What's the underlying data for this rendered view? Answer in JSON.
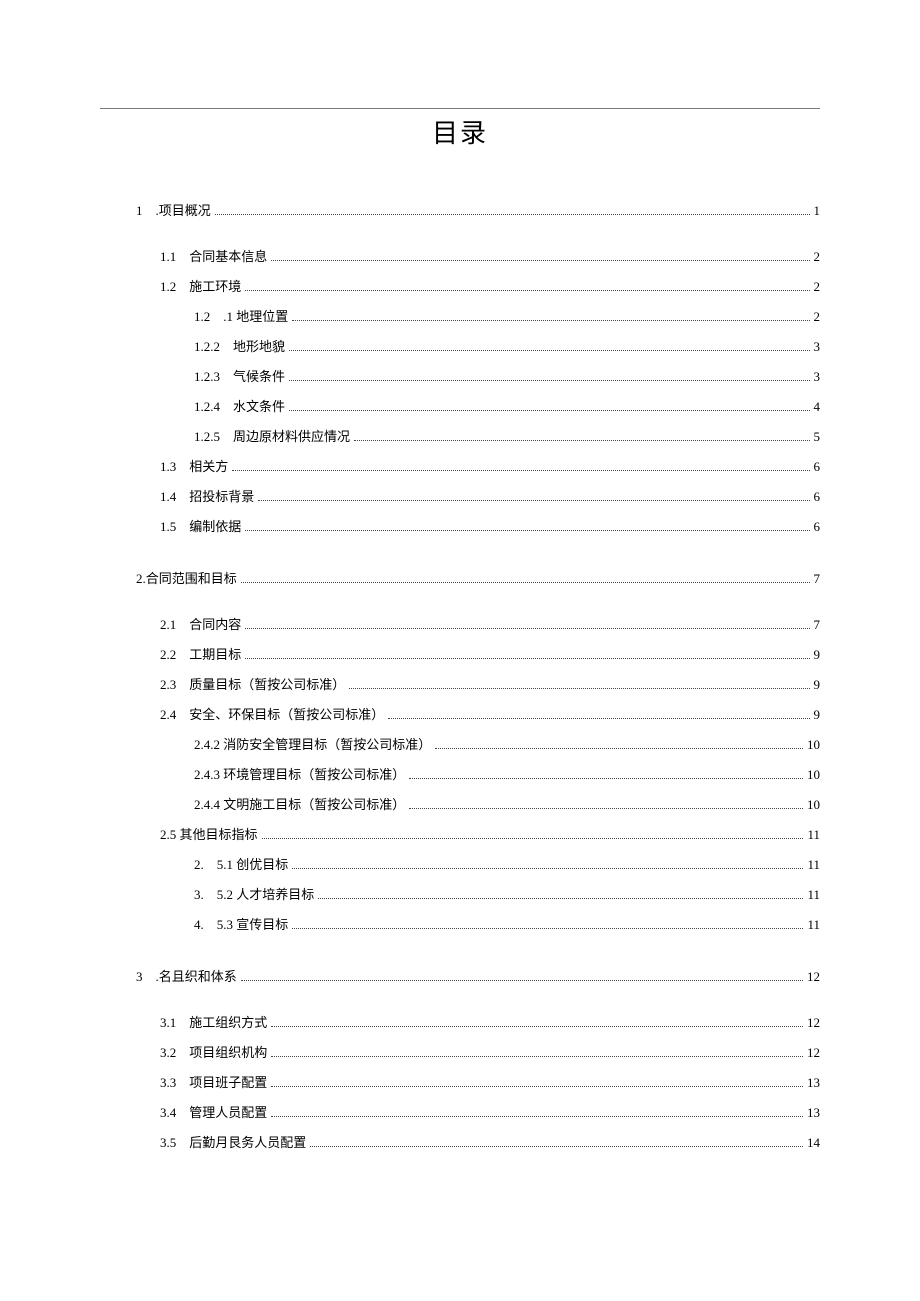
{
  "title": "目录",
  "toc": [
    {
      "level": 1,
      "num": "1",
      "sep": " .",
      "text": "项目概况",
      "page": "1",
      "gapAfter": true
    },
    {
      "level": 2,
      "num": "1.1",
      "sep": " ",
      "text": "合同基本信息",
      "page": "2"
    },
    {
      "level": 2,
      "num": "1.2",
      "sep": " ",
      "text": "施工环境",
      "page": "2"
    },
    {
      "level": 3,
      "num": "1.2",
      "sep": " ",
      "text": ".1 地理位置",
      "page": "2"
    },
    {
      "level": 3,
      "num": "1.2.2",
      "sep": " ",
      "text": "地形地貌",
      "page": "3"
    },
    {
      "level": 3,
      "num": "1.2.3",
      "sep": " ",
      "text": "气候条件",
      "page": "3"
    },
    {
      "level": 3,
      "num": "1.2.4",
      "sep": " ",
      "text": "水文条件",
      "page": "4"
    },
    {
      "level": 3,
      "num": "1.2.5",
      "sep": " ",
      "text": "周边原材料供应情况",
      "page": "5"
    },
    {
      "level": 2,
      "num": "1.3",
      "sep": " ",
      "text": "相关方",
      "page": "6"
    },
    {
      "level": 2,
      "num": "1.4",
      "sep": " ",
      "text": "招投标背景",
      "page": "6"
    },
    {
      "level": 2,
      "num": "1.5",
      "sep": " ",
      "text": "编制依据",
      "page": "6",
      "gapAfter": true
    },
    {
      "level": 1,
      "num": "2.",
      "sep": "",
      "text": "合同范围和目标",
      "page": "7",
      "gapAfter": true
    },
    {
      "level": 2,
      "num": "2.1",
      "sep": " ",
      "text": "合同内容",
      "page": "7"
    },
    {
      "level": 2,
      "num": "2.2",
      "sep": " ",
      "text": "工期目标",
      "page": "9"
    },
    {
      "level": 2,
      "num": "2.3",
      "sep": " ",
      "text": "质量目标（暂按公司标准）",
      "page": "9"
    },
    {
      "level": 2,
      "num": "2.4",
      "sep": " ",
      "text": "安全、环保目标（暂按公司标准）",
      "page": "9"
    },
    {
      "level": 3,
      "num": "2.4.2",
      "sep": " ",
      "text": "消防安全管理目标（暂按公司标准）",
      "page": "10"
    },
    {
      "level": 3,
      "num": "2.4.3",
      "sep": " ",
      "text": "环境管理目标（暂按公司标准）",
      "page": "10"
    },
    {
      "level": 3,
      "num": "2.4.4",
      "sep": " ",
      "text": "文明施工目标（暂按公司标准）",
      "page": "10"
    },
    {
      "level": 2,
      "num": "2.5",
      "sep": " ",
      "text": "其他目标指标",
      "page": "11"
    },
    {
      "level": 3,
      "num": "2.",
      "sep": " ",
      "text": "5.1 创优目标",
      "page": "11"
    },
    {
      "level": 3,
      "num": "3.",
      "sep": " ",
      "text": "5.2 人才培养目标",
      "page": "11"
    },
    {
      "level": 3,
      "num": "4.",
      "sep": " ",
      "text": "5.3 宣传目标",
      "page": "11",
      "gapAfter": true
    },
    {
      "level": 1,
      "num": "3",
      "sep": " .",
      "text": "名且织和体系",
      "page": "12",
      "gapAfter": true
    },
    {
      "level": 2,
      "num": "3.1",
      "sep": " ",
      "text": "施工组织方式",
      "page": "12"
    },
    {
      "level": 2,
      "num": "3.2",
      "sep": " ",
      "text": "项目组织机构",
      "page": "12"
    },
    {
      "level": 2,
      "num": "3.3",
      "sep": " ",
      "text": "项目班子配置",
      "page": "13"
    },
    {
      "level": 2,
      "num": "3.4",
      "sep": " ",
      "text": "管理人员配置",
      "page": "13"
    },
    {
      "level": 2,
      "num": "3.5",
      "sep": " ",
      "text": "后勤月艮务人员配置",
      "page": "14"
    }
  ]
}
